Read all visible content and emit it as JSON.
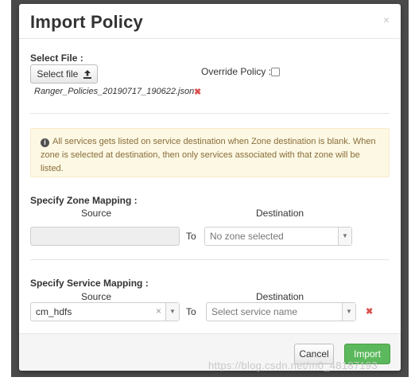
{
  "dialog": {
    "title": "Import Policy",
    "close": "×"
  },
  "file": {
    "label": "Select File :",
    "button_label": "Select file",
    "upload_icon": "upload-icon",
    "override_label": "Override Policy :",
    "override_checked": false,
    "selected_file": "Ranger_Policies_20190717_190622.json",
    "remove": "✖"
  },
  "alert": {
    "icon": "info-circle-icon",
    "text": "All services gets listed on service destination when Zone destination is blank. When zone is selected at destination, then only services associated with that zone will be listed."
  },
  "zone_mapping": {
    "label": "Specify Zone Mapping :",
    "source_header": "Source",
    "destination_header": "Destination",
    "source_value": "",
    "to_label": "To",
    "destination_placeholder": "No zone selected"
  },
  "service_mapping": {
    "label": "Specify Service Mapping :",
    "source_header": "Source",
    "destination_header": "Destination",
    "source_value": "cm_hdfs",
    "clear": "×",
    "to_label": "To",
    "destination_placeholder": "Select service name",
    "remove": "✖"
  },
  "footer": {
    "cancel_label": "Cancel",
    "import_label": "Import"
  },
  "watermark": "https://blog.csdn.net/m0_48187193",
  "colors": {
    "primary": "#5cb85c",
    "danger": "#d9534f",
    "alert_bg": "#fcf8e3",
    "alert_text": "#8a6d3b"
  }
}
